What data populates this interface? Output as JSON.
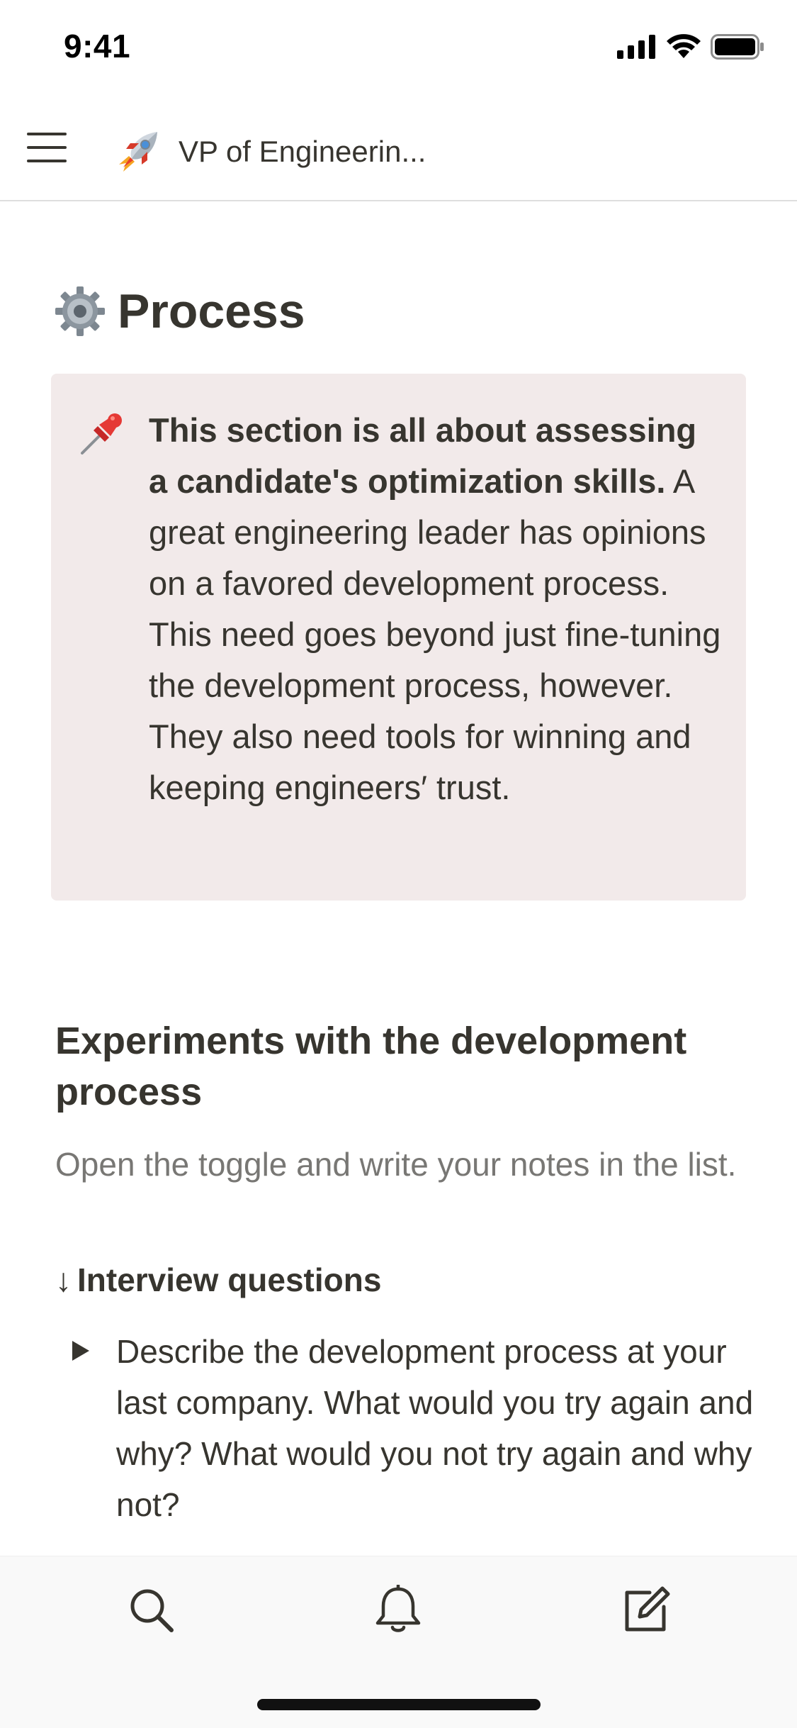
{
  "status_bar": {
    "time": "9:41"
  },
  "top_bar": {
    "page_title": "VP of Engineerin..."
  },
  "section": {
    "title": "Process"
  },
  "callout": {
    "bold_text": "This section is all about assessing a candidate's optimization skills.",
    "text": " A great engineering leader has opinions on a favored development process. This need goes beyond just fine-tuning the development process, however. They also need tools for winning and keeping engineers′ trust."
  },
  "subsection": {
    "title": "Experiments with the development process",
    "description": "Open the toggle and write your notes in the list.",
    "questions_heading": "Interview questions",
    "questions_arrow": "↓",
    "toggles": [
      {
        "text": "Describe the development process at your last company. What would you try again and why? What would you not try again and why not?"
      }
    ]
  },
  "icons": {
    "menu": "hamburger-menu-icon",
    "page": "rocket-icon",
    "section": "gear-icon",
    "callout": "pushpin-icon",
    "search": "search-icon",
    "notifications": "bell-icon",
    "compose": "compose-icon"
  }
}
